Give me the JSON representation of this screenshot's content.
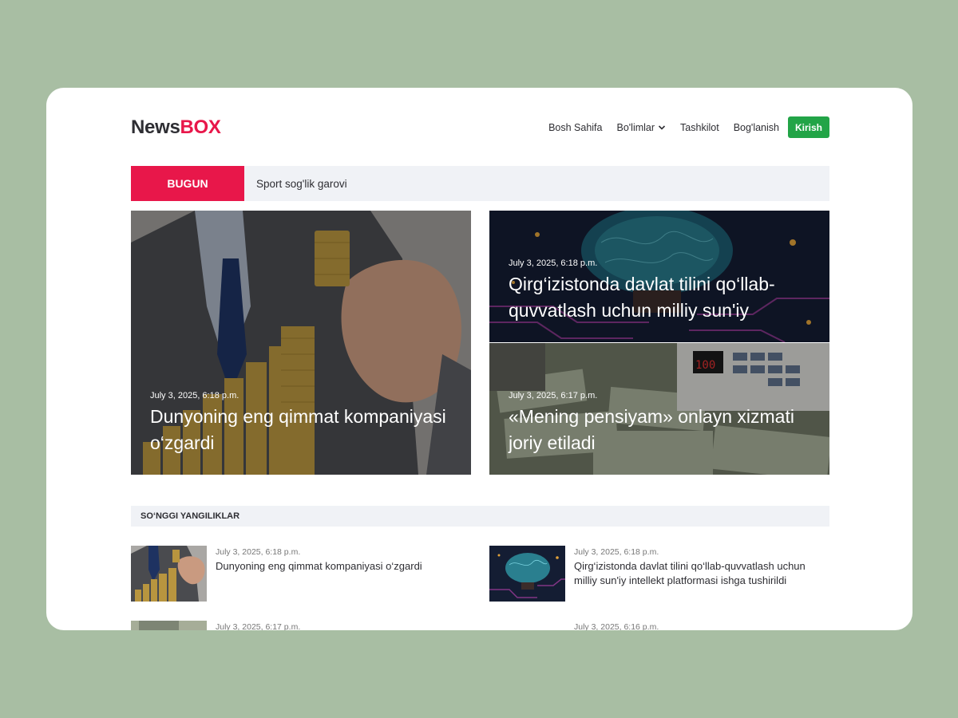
{
  "header": {
    "logo_news": "News",
    "logo_box": "BOX",
    "nav": [
      "Bosh Sahifa",
      "Bo'limlar",
      "Tashkilot",
      "Bog'lanish"
    ],
    "login": "Kirish"
  },
  "ticker": {
    "label": "BUGUN",
    "text": "Sport sog'lik garovi"
  },
  "hero": {
    "main": {
      "date": "July 3, 2025, 6:18 p.m.",
      "title": "Dunyoning eng qimmat kompaniyasi o‘zgardi"
    },
    "top": {
      "date": "July 3, 2025, 6:18 p.m.",
      "title": "Qirg‘izistonda davlat tilini qo‘llab-quvvatlash uchun milliy sun'iy"
    },
    "bottom": {
      "date": "July 3, 2025, 6:17 p.m.",
      "title": "«Mening pensiyam» onlayn xizmati joriy etiladi"
    }
  },
  "latest": {
    "heading": "SO‘NGGI YANGILIKLAR",
    "items": [
      {
        "date": "July 3, 2025, 6:18 p.m.",
        "title": "Dunyoning eng qimmat kompaniyasi o‘zgardi"
      },
      {
        "date": "July 3, 2025, 6:18 p.m.",
        "title": "Qirg‘izistonda davlat tilini qo‘llab-quvvatlash uchun milliy sun'iy intellekt platformasi ishga tushirildi"
      },
      {
        "date": "July 3, 2025, 6:17 p.m.",
        "title": ""
      },
      {
        "date": "July 3, 2025, 6:16 p.m.",
        "title": ""
      }
    ]
  },
  "colors": {
    "brand_red": "#e8174a",
    "login_green": "#22a447",
    "bg_green": "#a8bea3"
  }
}
